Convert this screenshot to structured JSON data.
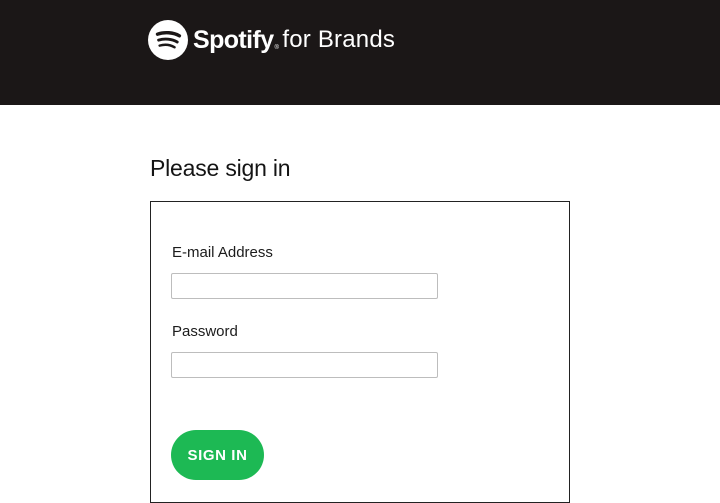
{
  "header": {
    "brand_name": "Spotify",
    "brand_reg": "®",
    "brand_suffix": "for Brands",
    "logo_icon": "spotify-logo-icon",
    "background_color": "#1b1717"
  },
  "page": {
    "title": "Please sign in"
  },
  "form": {
    "email": {
      "label": "E-mail Address",
      "value": "",
      "placeholder": ""
    },
    "password": {
      "label": "Password",
      "value": "",
      "placeholder": ""
    },
    "submit_label": "SIGN IN",
    "submit_color": "#1db954"
  }
}
